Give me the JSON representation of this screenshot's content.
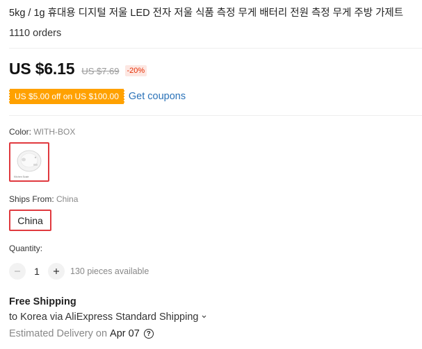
{
  "product": {
    "title": "5kg / 1g 휴대용 디지털 저울 LED 전자 저울 식품 측정 무게 배터리 전원 측정 무게 주방 가제트",
    "orders": "1110 orders"
  },
  "price": {
    "current": "US $6.15",
    "original": "US $7.69",
    "discount": "-20%"
  },
  "coupon": {
    "tag": "US $5.00 off on US $100.00",
    "link": "Get coupons"
  },
  "color": {
    "label": "Color: ",
    "value": "WITH-BOX",
    "swatch_caption": "Kitchen Scale"
  },
  "ships_from": {
    "label": "Ships From: ",
    "value": "China",
    "option": "China"
  },
  "quantity": {
    "label": "Quantity:",
    "value": "1",
    "available": "130 pieces available"
  },
  "shipping": {
    "free": "Free Shipping",
    "via": "to Korea via AliExpress Standard Shipping",
    "delivery_label": "Estimated Delivery on",
    "delivery_date": "Apr 07"
  },
  "colors": {
    "accent_red": "#e0393e",
    "coupon_orange": "#ffa100",
    "link_blue": "#2a72b8"
  }
}
